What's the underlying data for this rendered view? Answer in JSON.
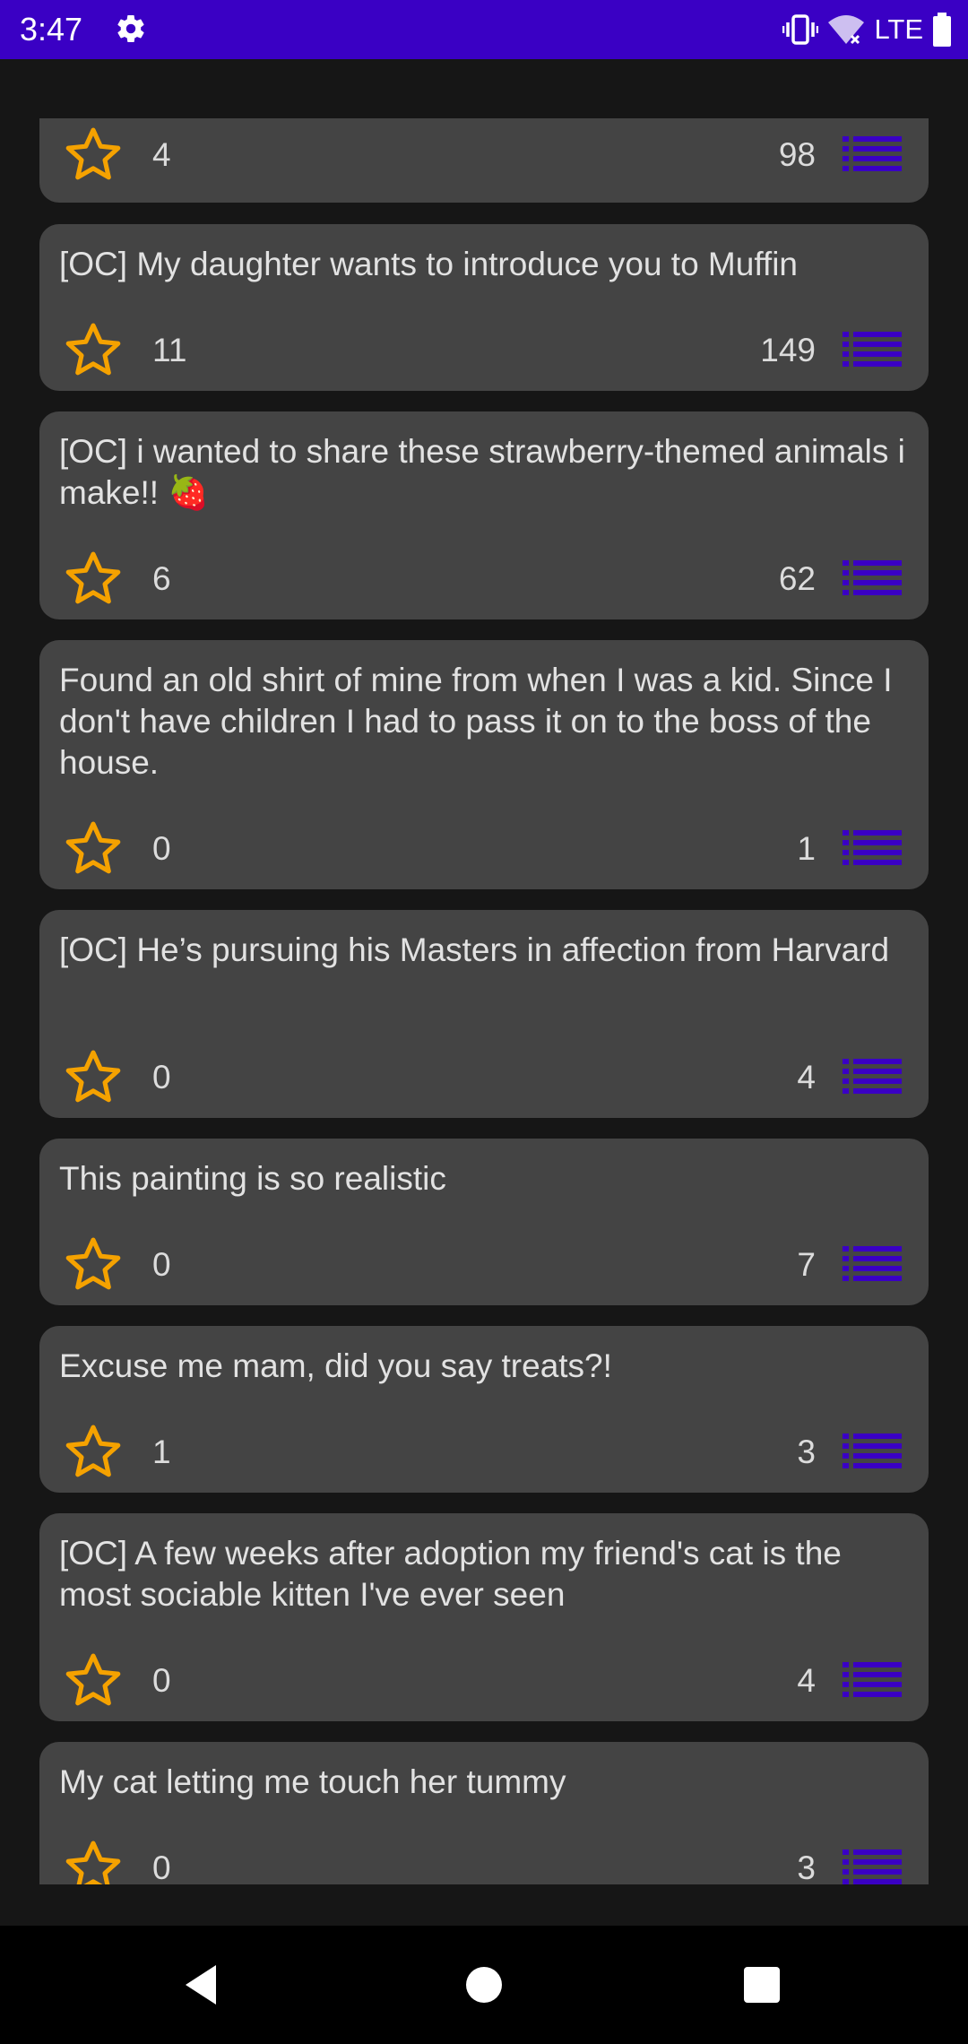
{
  "status_bar": {
    "time": "3:47",
    "network": "LTE",
    "color": "#3a00c4",
    "icons": [
      "settings-gear-icon",
      "vibrate-icon",
      "wifi-icon",
      "battery-icon"
    ]
  },
  "theme": {
    "card_background": "#444444",
    "star_color": "#f5a200",
    "list_icon_color": "#3a00c4",
    "background": "#161616"
  },
  "posts": [
    {
      "title": "",
      "stars": "4",
      "comments": "98"
    },
    {
      "title": "[OC] My daughter wants to introduce you to Muffin",
      "stars": "11",
      "comments": "149"
    },
    {
      "title": "[OC] i wanted to share these strawberry-themed animals i make!! 🍓",
      "stars": "6",
      "comments": "62"
    },
    {
      "title": "Found an old shirt of mine from when I was a kid. Since I don't have children I had to pass it on to the boss of the house.",
      "stars": "0",
      "comments": "1"
    },
    {
      "title": "[OC] He’s pursuing his Masters in affection from Harvard",
      "stars": "0",
      "comments": "4"
    },
    {
      "title": "This painting is so realistic",
      "stars": "0",
      "comments": "7"
    },
    {
      "title": "Excuse me mam, did you say treats?!",
      "stars": "1",
      "comments": "3"
    },
    {
      "title": "[OC] A few weeks after adoption my friend's cat is the most sociable kitten I've ever seen",
      "stars": "0",
      "comments": "4"
    },
    {
      "title": "My cat letting me touch her tummy",
      "stars": "0",
      "comments": "3"
    }
  ],
  "nav_bar": {
    "buttons": [
      "back-icon",
      "home-icon",
      "recents-icon"
    ]
  }
}
